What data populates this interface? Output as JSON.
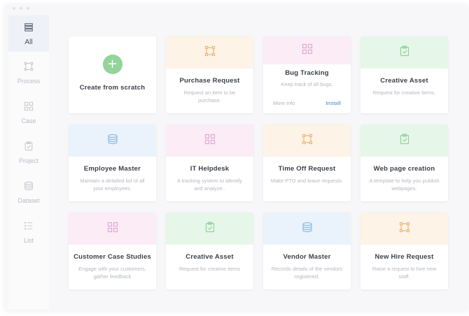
{
  "sidebar": {
    "items": [
      {
        "label": "All",
        "icon": "stack-icon",
        "active": true
      },
      {
        "label": "Process",
        "icon": "flow-icon"
      },
      {
        "label": "Case",
        "icon": "grid-icon"
      },
      {
        "label": "Project",
        "icon": "clipboard-icon"
      },
      {
        "label": "Dataset",
        "icon": "database-icon"
      },
      {
        "label": "List",
        "icon": "list-icon"
      }
    ]
  },
  "scratch": {
    "label": "Create from scratch",
    "plus": "+"
  },
  "cards": [
    {
      "title": "Purchase Request",
      "desc": "Request an item to be purchase.",
      "icon": "flow-icon",
      "color": "#fdf3e6",
      "stroke": "#f0b77a"
    },
    {
      "title": "Bug Tracking",
      "desc": "Keep track of all bugs.",
      "icon": "grid-icon",
      "color": "#fbecf6",
      "stroke": "#e3a8d2",
      "more": "More info",
      "install": "Install"
    },
    {
      "title": "Creative Asset",
      "desc": "Request for creative items.",
      "icon": "clipboard-icon",
      "color": "#e6f7ea",
      "stroke": "#8fd39b"
    },
    {
      "title": "Employee Master",
      "desc": "Maintain a detailed list of all your employees.",
      "icon": "database-icon",
      "color": "#eaf3fc",
      "stroke": "#8dbbe6"
    },
    {
      "title": "IT Helpdesk",
      "desc": "A tracking system to identify and analyze..",
      "icon": "grid-icon",
      "color": "#fbecf6",
      "stroke": "#e3a8d2"
    },
    {
      "title": "Time Off Request",
      "desc": "Make PTO and leave requests.",
      "icon": "flow-icon",
      "color": "#fdf3e6",
      "stroke": "#f0b77a"
    },
    {
      "title": "Web page creation",
      "desc": "A template to help you publish webpages.",
      "icon": "clipboard-icon",
      "color": "#e6f7ea",
      "stroke": "#8fd39b"
    },
    {
      "title": "Customer Case Studies",
      "desc": "Engage with your customers, gather feedback",
      "icon": "grid-icon",
      "color": "#fbecf6",
      "stroke": "#e3a8d2"
    },
    {
      "title": "Creative Asset",
      "desc": "Request for creative items",
      "icon": "clipboard-icon",
      "color": "#e6f7ea",
      "stroke": "#8fd39b"
    },
    {
      "title": "Vendor Master",
      "desc": "Records details of the vendors registered.",
      "icon": "database-icon",
      "color": "#eaf3fc",
      "stroke": "#8dbbe6"
    },
    {
      "title": "New Hire Request",
      "desc": "Raise a request to hire new staff.",
      "icon": "flow-icon",
      "color": "#fdf3e6",
      "stroke": "#f0b77a"
    }
  ]
}
